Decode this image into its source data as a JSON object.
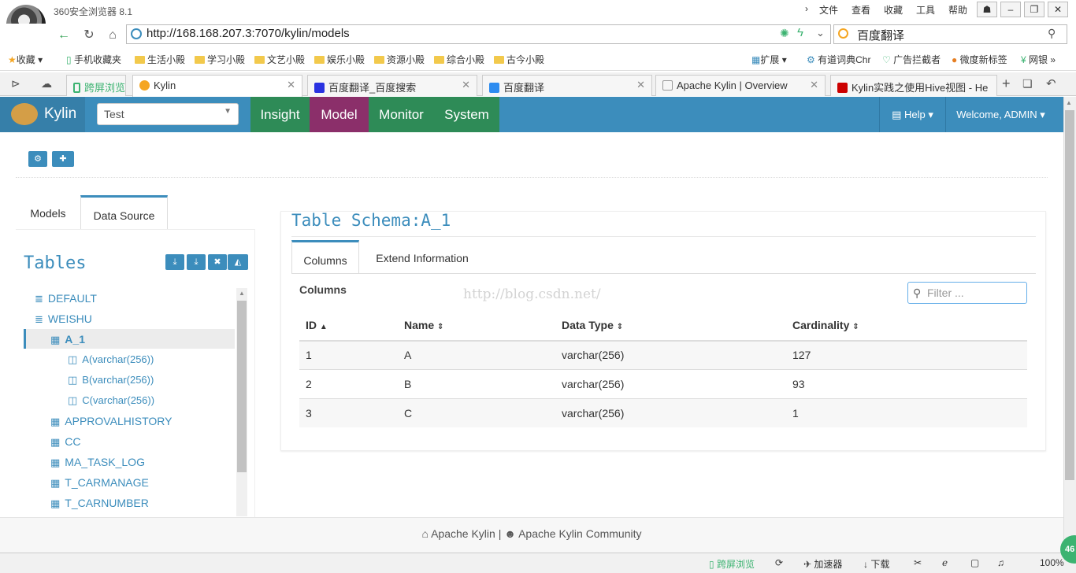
{
  "browser": {
    "app_title": "360安全浏览器 8.1",
    "menu": [
      "文件",
      "查看",
      "收藏",
      "工具",
      "帮助"
    ],
    "url": "http://168.168.207.3:7070/kylin/models",
    "search_text": "百度翻译",
    "bookmarks": [
      "收藏",
      "手机收藏夹",
      "生活小殿",
      "学习小殿",
      "文艺小殿",
      "娱乐小殿",
      "资源小殿",
      "综合小殿",
      "古今小殿"
    ],
    "bookmark_right": [
      "扩展",
      "有道词典Chr",
      "广告拦截者",
      "微度新标签",
      "网银"
    ],
    "tabs": [
      {
        "label": "跨屏浏览"
      },
      {
        "label": "Kylin"
      },
      {
        "label": "百度翻译_百度搜索"
      },
      {
        "label": "百度翻译"
      },
      {
        "label": "Apache Kylin | Overview"
      },
      {
        "label": "Kylin实践之使用Hive视图 - He"
      }
    ],
    "status": {
      "cross_screen": "跨屏浏览",
      "accelerator": "加速器",
      "download": "下载",
      "zoom": "100%",
      "badge": "46"
    }
  },
  "kylin": {
    "brand": "Kylin",
    "project": "Test",
    "nav": [
      "Insight",
      "Model",
      "Monitor",
      "System"
    ],
    "active_nav": "Model",
    "help": "Help",
    "welcome": "Welcome, ADMIN",
    "left_tabs": [
      "Models",
      "Data Source"
    ],
    "tables_title": "Tables",
    "tree": {
      "databases": [
        "DEFAULT",
        "WEISHU"
      ],
      "selected_table": "A_1",
      "columns": [
        "A(varchar(256))",
        "B(varchar(256))",
        "C(varchar(256))"
      ],
      "other_tables": [
        "APPROVALHISTORY",
        "CC",
        "MA_TASK_LOG",
        "T_CARMANAGE",
        "T_CARNUMBER"
      ]
    },
    "schema_title": "Table Schema:A_1",
    "right_tabs": [
      "Columns",
      "Extend Information"
    ],
    "columns_label": "Columns",
    "watermark": "http://blog.csdn.net/",
    "filter_placeholder": "Filter ...",
    "table": {
      "headers": [
        "ID",
        "Name",
        "Data Type",
        "Cardinality"
      ],
      "rows": [
        [
          "1",
          "A",
          "varchar(256)",
          "127"
        ],
        [
          "2",
          "B",
          "varchar(256)",
          "93"
        ],
        [
          "3",
          "C",
          "varchar(256)",
          "1"
        ]
      ]
    },
    "footer": {
      "link1": "Apache Kylin",
      "sep": "|",
      "link2": "Apache Kylin Community"
    }
  },
  "colors": {
    "primary": "#3c8dbc",
    "nav_green": "#2e8b57",
    "model_active": "#8b2f6a"
  }
}
